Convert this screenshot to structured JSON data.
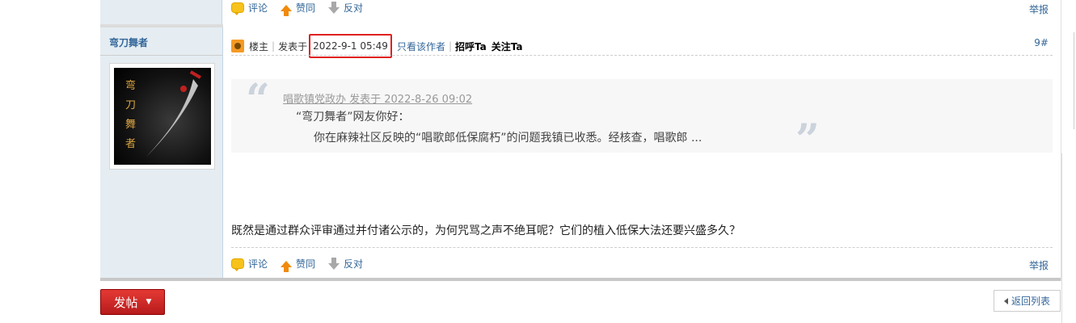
{
  "prev_post": {
    "actions": {
      "comment": "评论",
      "like": "赞同",
      "dislike": "反对"
    },
    "report": "举报"
  },
  "post": {
    "author": "弯刀舞者",
    "op_label": "楼主",
    "posted_prefix": "发表于",
    "date": "2022-9-1 05:49",
    "only_author": "只看该作者",
    "greet": "招呼Ta",
    "follow": "关注Ta",
    "floor": "9#",
    "quote": {
      "meta": "唱歌镇党政办 发表于 2022-8-26 09:02",
      "line1": "“弯刀舞者”网友你好：",
      "line2": "你在麻辣社区反映的“唱歌郎低保腐朽”的问题我镇已收悉。经核查，唱歌郎 ..."
    },
    "body": "既然是通过群众评审通过并付诸公示的，为何咒骂之声不绝耳呢？它们的植入低保大法还要兴盛多久？",
    "actions": {
      "comment": "评论",
      "like": "赞同",
      "dislike": "反对"
    },
    "report": "举报"
  },
  "footer": {
    "post_button": "发帖",
    "back_button": "返回列表"
  },
  "colors": {
    "link": "#336699",
    "post_button": "#c62828",
    "highlight_box": "#e02020",
    "sidebar_bg": "#e5edf2"
  }
}
